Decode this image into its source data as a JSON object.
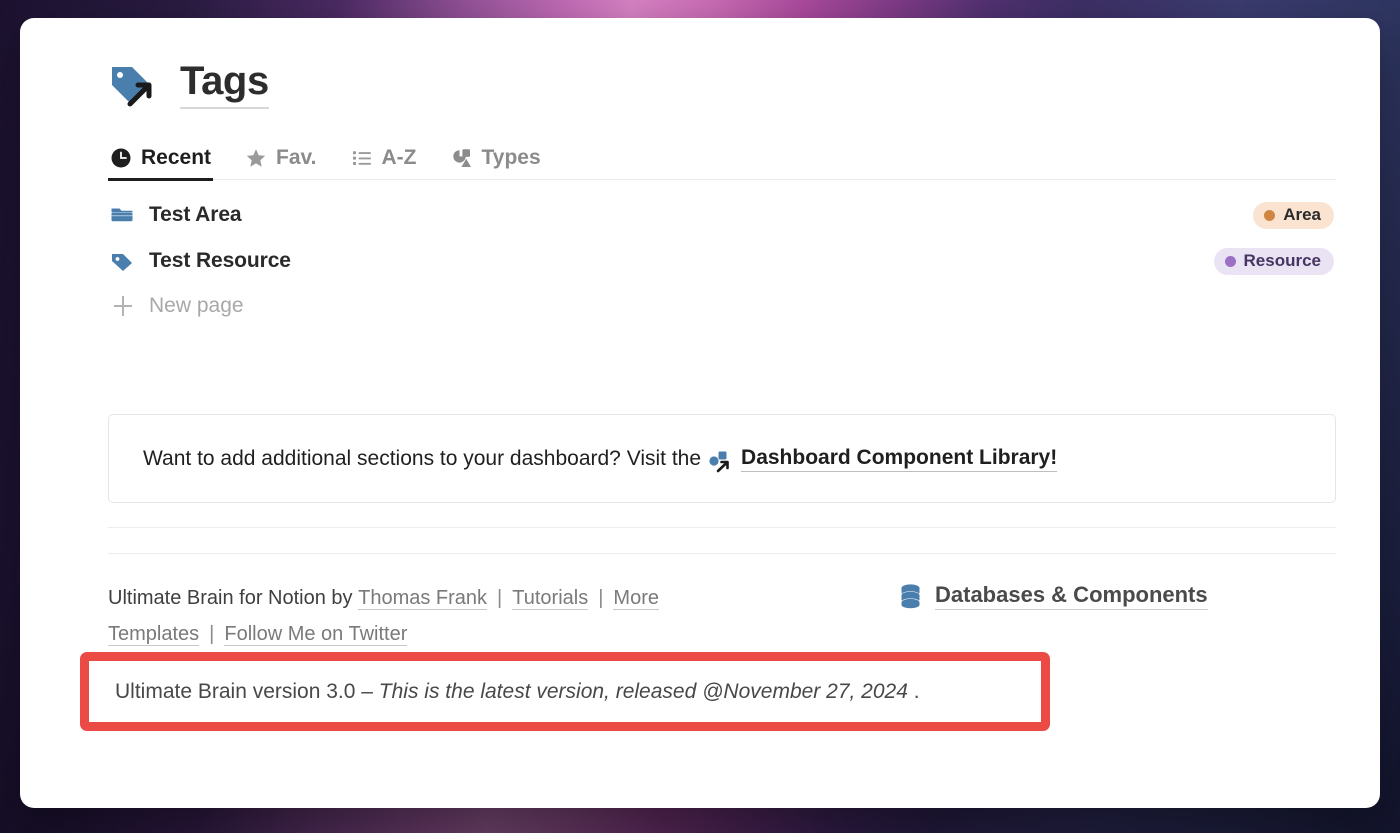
{
  "window": {
    "background_gradient": [
      "#1c1230",
      "#d681c2",
      "#1f2648"
    ]
  },
  "header": {
    "title": "Tags",
    "icon": "tag-link-icon",
    "icon_color": "#4a7fad"
  },
  "tabs": [
    {
      "label": "Recent",
      "icon": "clock-icon",
      "active": true
    },
    {
      "label": "Fav.",
      "icon": "star-icon",
      "active": false
    },
    {
      "label": "A-Z",
      "icon": "list-icon",
      "active": false
    },
    {
      "label": "Types",
      "icon": "shapes-icon",
      "active": false
    }
  ],
  "list": {
    "rows": [
      {
        "label": "Test Area",
        "icon": "folder-icon",
        "icon_color": "#4a7fad",
        "tag": {
          "label": "Area",
          "dot_color": "#d08642",
          "bg_color": "#fae3d0",
          "text_color": "#2b2b2b"
        }
      },
      {
        "label": "Test Resource",
        "icon": "tag-icon",
        "icon_color": "#4a7fad",
        "tag": {
          "label": "Resource",
          "dot_color": "#9b6fc4",
          "bg_color": "#eae3f4",
          "text_color": "#453560"
        }
      }
    ],
    "new_page_label": "New page"
  },
  "callout": {
    "text_before": "Want to add additional sections to your dashboard? Visit the",
    "icon": "component-link-icon",
    "link_label": "Dashboard Component Library!"
  },
  "footer": {
    "intro": "Ultimate Brain for Notion by",
    "links": [
      "Thomas Frank",
      "Tutorials",
      "More Templates",
      "Follow Me on Twitter"
    ],
    "link_1": "Thomas Frank",
    "link_2": "Tutorials",
    "link_3": "More Templates",
    "link_4": "Follow Me on Twitter",
    "separator": "|",
    "databases": {
      "icon": "database-icon",
      "label": "Databases & Components"
    }
  },
  "version_notice": {
    "prefix": "Ultimate Brain version 3.0 – ",
    "italic_part": "This is the latest version, released @November 27, 2024",
    "suffix": " .",
    "highlight_color": "#ec4a45"
  }
}
